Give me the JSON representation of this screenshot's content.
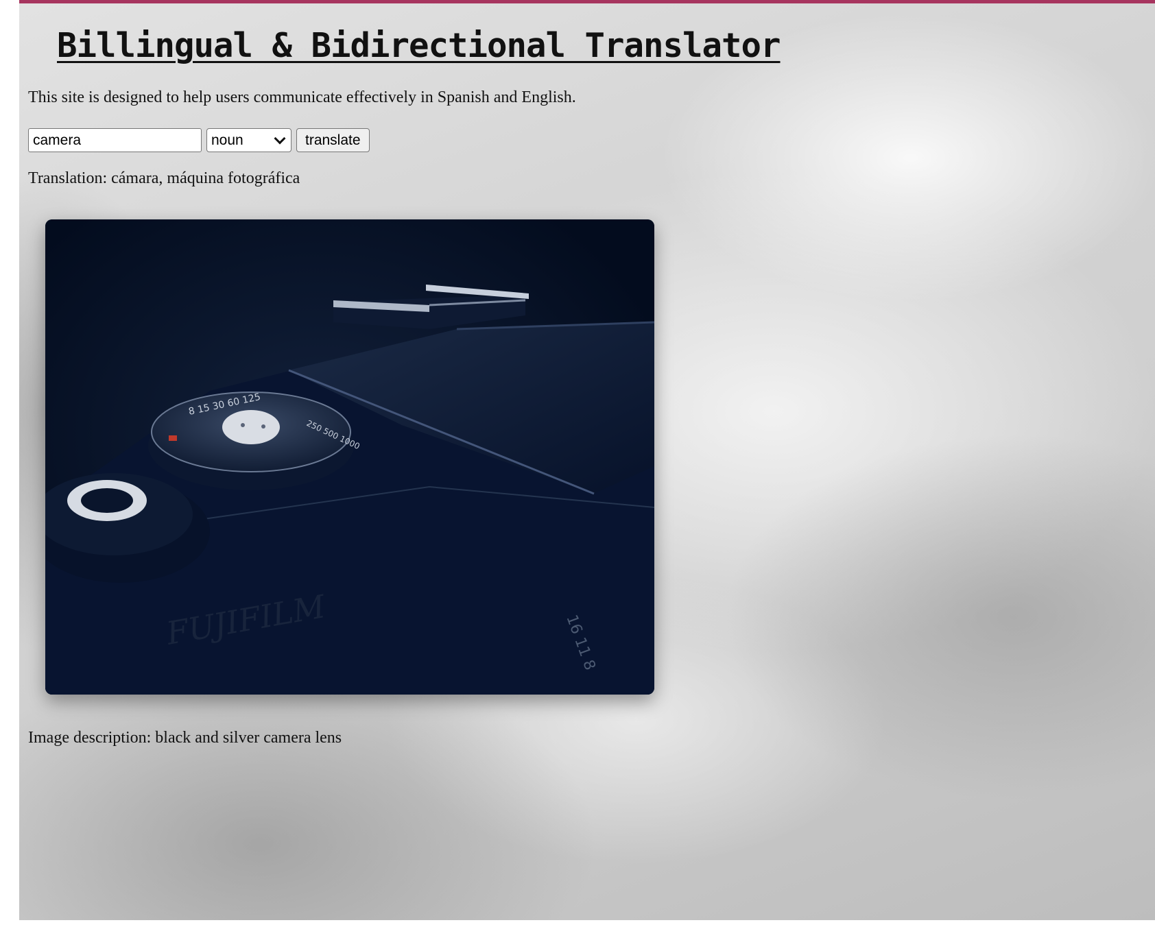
{
  "page": {
    "title": "Billingual & Bidirectional Translator",
    "intro": "This site is designed to help users communicate effectively in Spanish and English."
  },
  "form": {
    "word_value": "camera",
    "part_of_speech": "noun",
    "translate_label": "translate"
  },
  "result": {
    "translation_text": "Translation: cámara, máquina fotográfica"
  },
  "image": {
    "description_text": "Image description: black and silver camera lens"
  },
  "colors": {
    "accent_bar": "#a7355f",
    "photo_background": "#030c1e"
  }
}
